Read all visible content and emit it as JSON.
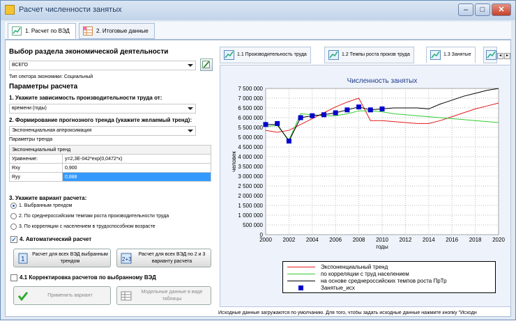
{
  "window": {
    "title": "Расчет численности занятых",
    "minimize": "–",
    "maximize": "□",
    "close": "✕"
  },
  "top_tabs": [
    {
      "label": "1. Расчет по ВЭД",
      "icon": "chart-line-icon"
    },
    {
      "label": "2. Итоговые данные",
      "icon": "table-grid-icon"
    }
  ],
  "left": {
    "section_title": "Выбор раздела экономической деятельности",
    "section_value": "ВСЕГО",
    "sector_type": "Тип сектора экономики: Социальный",
    "params_title": "Параметры расчета",
    "step1": "1. Укажите зависимость производительности труда от:",
    "step1_value": "времени (годы)",
    "step2": "2. Формирование прогнозного тренда (укажите желаемый тренд):",
    "step2_value": "Экспоненциальная аппроксимация",
    "trend_params_label": "Параметры тренда",
    "trend_table": {
      "header": "Экспоненциальный тренд",
      "rows": [
        {
          "name": "Уравнение:",
          "value": "y=2,3E-042*exp(0,0472*x)"
        },
        {
          "name": "Rxy",
          "value": "0,900"
        },
        {
          "name": "Ryy",
          "value": "0,888"
        }
      ]
    },
    "step3": "3. Укажите вариант расчета:",
    "variants": [
      "1. Выбранным трендом",
      "2. По среднероссийским темпам роста производительности труда",
      "3. По корреляции с населением в трудоспособном возрасте"
    ],
    "selected_variant": 0,
    "auto_calc_label": "4. Автоматический расчет",
    "auto_calc_checked": true,
    "btn_calc_all": "Расчет для всех ВЭД выбранным трендом",
    "btn_calc_23": "Расчет для всех ВЭД по 2 и 3 варианту расчета",
    "correction_label": "4.1 Корректировка расчетов по выбранному ВЭД",
    "correction_checked": false,
    "btn_apply": "Применить вариант",
    "btn_model": "Модельные данные в виде таблицы"
  },
  "chart_tabs": [
    {
      "label": "1.1 Производительность труда"
    },
    {
      "label": "1.2 Темпы роста произв труда"
    },
    {
      "label": "1.3 Занятые"
    },
    {
      "label": ""
    }
  ],
  "nav_left": "◂",
  "nav_right": "▸",
  "status": "Исходные данные загружаются по умолчанию. Для того, чтобы задать исходные данные нажмите кнопку \"Исходн",
  "colors": {
    "exp_trend": "#e31a1c",
    "correlation": "#33cc33",
    "avg_russia": "#000000",
    "actual": "#0000cc"
  },
  "chart_data": {
    "type": "line",
    "title": "Численность занятых",
    "xlabel": "годы",
    "ylabel": "человек",
    "xlim": [
      2000,
      2020
    ],
    "ylim": [
      0,
      7500000
    ],
    "x_ticks": [
      "2000",
      "2002",
      "2004",
      "2006",
      "2008",
      "2010",
      "2012",
      "2014",
      "2016",
      "2018",
      "2020"
    ],
    "y_ticks": [
      "0",
      "500 000",
      "1 000 000",
      "1 500 000",
      "2 000 000",
      "2 500 000",
      "3 000 000",
      "3 500 000",
      "4 000 000",
      "4 500 000",
      "5 000 000",
      "5 500 000",
      "6 000 000",
      "6 500 000",
      "7 000 000",
      "7 500 000"
    ],
    "grid": true,
    "legend_position": "bottom",
    "series": [
      {
        "name": "Экспоненциальный тренд",
        "color_key": "exp_trend",
        "x": [
          2000,
          2001,
          2002,
          2003,
          2004,
          2005,
          2006,
          2007,
          2008,
          2009,
          2010,
          2011,
          2012,
          2013,
          2014,
          2015,
          2016,
          2017,
          2018,
          2019,
          2020
        ],
        "y": [
          5350000,
          5250000,
          5350000,
          5650000,
          5950000,
          6250000,
          6550000,
          6800000,
          7000000,
          5850000,
          5850000,
          5800000,
          5750000,
          5700000,
          5700000,
          5850000,
          6050000,
          6250000,
          6450000,
          6600000,
          6750000
        ]
      },
      {
        "name": "по корреляции с труд населением",
        "color_key": "correlation",
        "x": [
          2000,
          2001,
          2002,
          2003,
          2004,
          2005,
          2006,
          2007,
          2008,
          2009,
          2010,
          2011,
          2012,
          2013,
          2014,
          2015,
          2016,
          2017,
          2018,
          2019,
          2020
        ],
        "y": [
          5550000,
          5600000,
          4850000,
          6200000,
          6150000,
          6100000,
          6100000,
          6200000,
          6350000,
          6350000,
          6300000,
          6200000,
          6150000,
          6100000,
          6050000,
          6000000,
          5950000,
          5900000,
          5850000,
          5800000,
          5750000
        ]
      },
      {
        "name": "на основе среднероссийских темпов роста ПрТр",
        "color_key": "avg_russia",
        "x": [
          2000,
          2001,
          2002,
          2003,
          2004,
          2005,
          2006,
          2007,
          2008,
          2009,
          2010,
          2011,
          2012,
          2013,
          2014,
          2015,
          2016,
          2017,
          2018,
          2019,
          2020
        ],
        "y": [
          5650000,
          5650000,
          4800000,
          6000000,
          6100000,
          6150000,
          6250000,
          6400000,
          6550000,
          6400000,
          6450000,
          6500000,
          6500000,
          6500000,
          6450000,
          6700000,
          6900000,
          7100000,
          7250000,
          7400000,
          7500000
        ]
      },
      {
        "name": "Занятые_исх",
        "color_key": "actual",
        "marker": "square",
        "x": [
          2000,
          2001,
          2002,
          2003,
          2004,
          2005,
          2006,
          2007,
          2008,
          2009,
          2010
        ],
        "y": [
          5650000,
          5700000,
          4800000,
          6000000,
          6100000,
          6150000,
          6250000,
          6400000,
          6550000,
          6400000,
          6450000
        ]
      }
    ]
  }
}
